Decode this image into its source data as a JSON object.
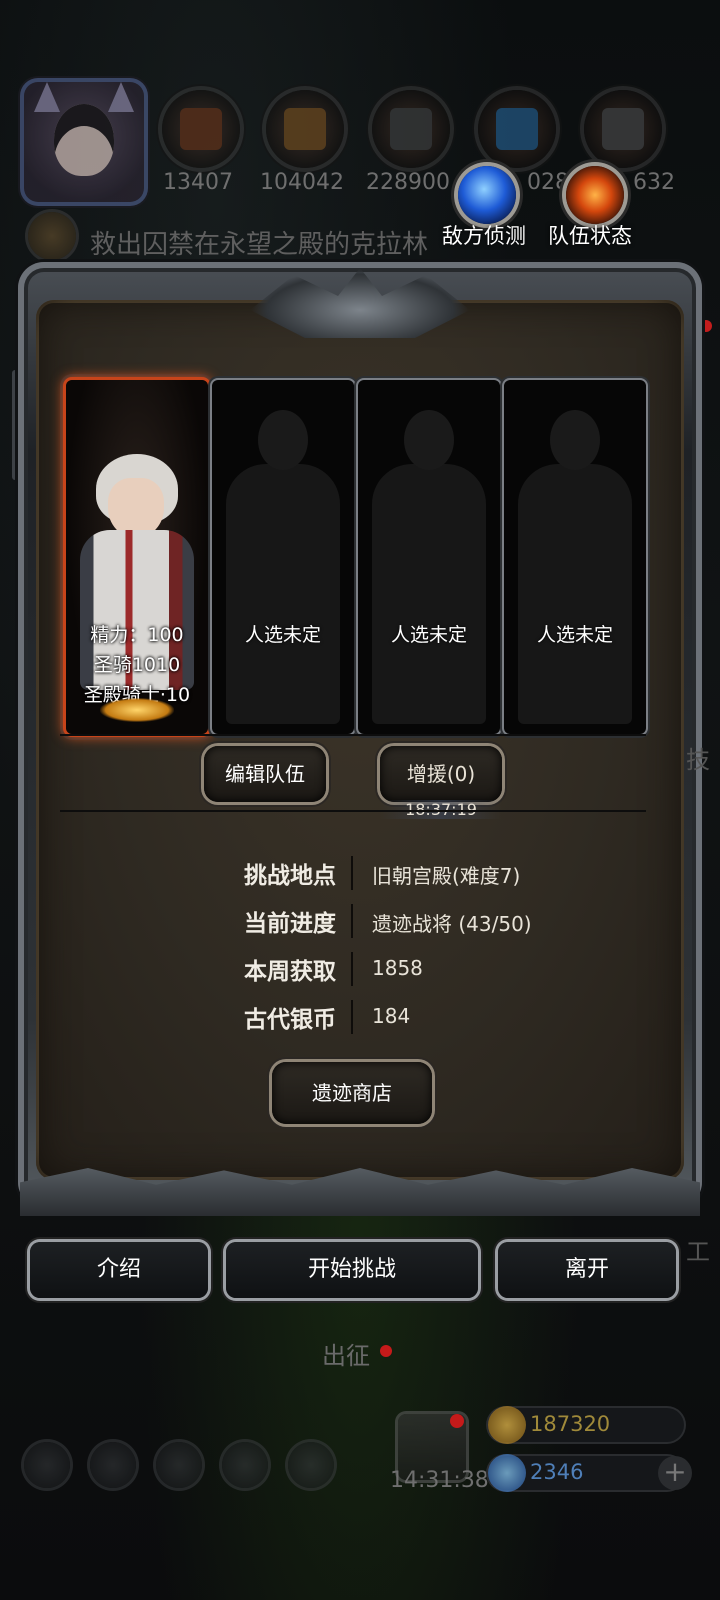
{
  "top": {
    "resources": [
      {
        "icon": "wood-log-icon",
        "count": "13407"
      },
      {
        "icon": "planks-icon",
        "count": "104042"
      },
      {
        "icon": "iron-ingot-icon",
        "count": "228900"
      },
      {
        "icon": "crystal-icon",
        "count": "028"
      },
      {
        "icon": "steel-icon",
        "count": "632"
      }
    ],
    "quest_text": "救出囚禁在永望之殿的克拉林",
    "enemy_scout_label": "敌方侦测",
    "team_status_label": "队伍状态"
  },
  "team": {
    "hero": {
      "stamina": "精力：100",
      "name": "圣骑1010",
      "class_level": "圣殿骑士·10"
    },
    "empty_slot_label": "人选未定"
  },
  "actions": {
    "edit_team": "编辑队伍",
    "reinforce": "增援(0)",
    "timer": "18:37:19",
    "shop": "遗迹商店"
  },
  "info": [
    {
      "label": "挑战地点",
      "value": "旧朝宫殿(难度7)"
    },
    {
      "label": "当前进度",
      "value": "遗迹战将 (43/50)"
    },
    {
      "label": "本周获取",
      "value": "1858"
    },
    {
      "label": "古代银币",
      "value": "184"
    }
  ],
  "bottom_buttons": {
    "intro": "介绍",
    "start": "开始挑战",
    "leave": "离开"
  },
  "background": {
    "march_label": "出征",
    "edge_text_1": "技",
    "edge_text_2": "工",
    "clock": "14:31:38",
    "gold": "187320",
    "gems": "2346",
    "plus": "+"
  },
  "colors": {
    "accent_orange": "#c7441a",
    "gold_text": "#a08a3a",
    "gem_text": "#4f7fb8"
  }
}
